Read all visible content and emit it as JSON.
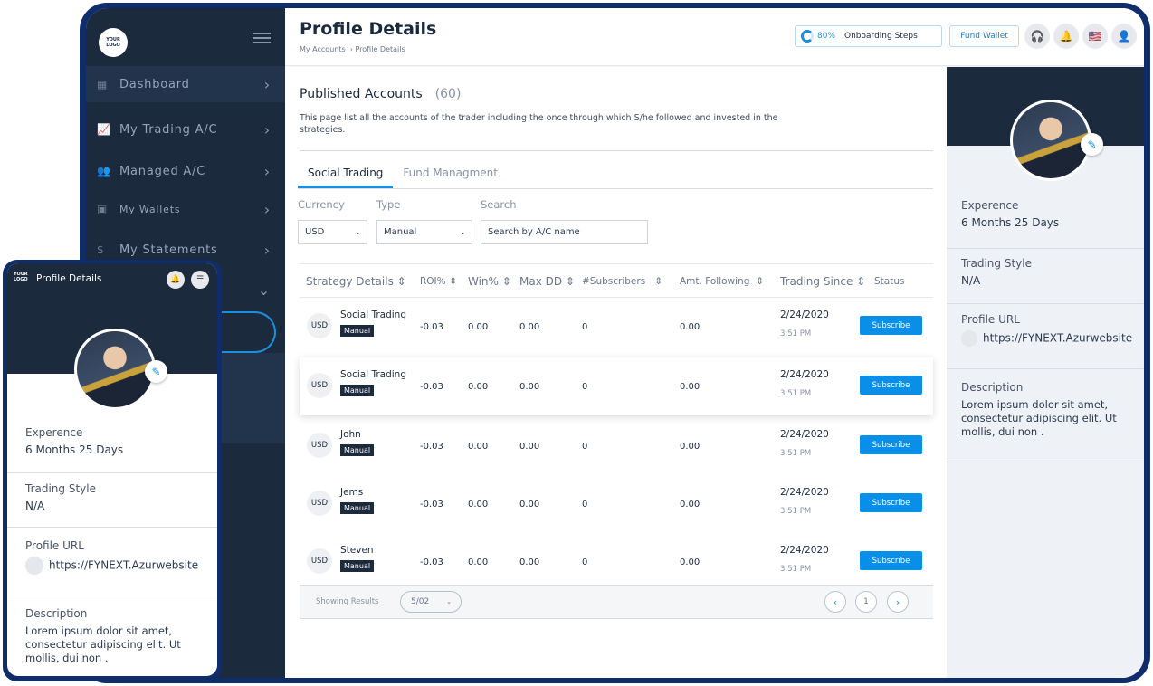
{
  "sidebar": {
    "logo": [
      "YOUR",
      "LOGO"
    ],
    "items": [
      {
        "label": "Dashboard",
        "icon": "dashboard-icon"
      },
      {
        "label": "My Trading A/C",
        "icon": "chart-icon"
      },
      {
        "label": "Managed A/C",
        "icon": "users-icon"
      },
      {
        "label": "My Wallets",
        "icon": "wallet-icon"
      },
      {
        "label": "My Statements",
        "icon": "statement-icon"
      }
    ]
  },
  "header": {
    "title": "Profile Details",
    "breadcrumb": [
      "My Accounts",
      "Profile Details"
    ],
    "onboarding_pct": "80%",
    "onboarding_label": "Onboarding Steps",
    "fund_wallet": "Fund Wallet"
  },
  "content": {
    "title": "Published Accounts",
    "count": "(60)",
    "description": "This page list all the accounts of the trader including the once through which S/he followed and invested in the strategies.",
    "tabs": [
      "Social Trading",
      "Fund Managment"
    ],
    "filters": {
      "currency_label": "Currency",
      "currency_value": "USD",
      "type_label": "Type",
      "type_value": "Manual",
      "search_label": "Search",
      "search_placeholder": "Search by A/C name"
    },
    "columns": [
      "Strategy Details",
      "ROI%",
      "Win%",
      "Max DD",
      "#Subscribers",
      "Amt. Following",
      "Trading Since",
      "Status"
    ],
    "rows": [
      {
        "currency": "USD",
        "name": "Social Trading",
        "type": "Manual",
        "roi": "-0.03",
        "win": "0.00",
        "maxdd": "0.00",
        "subs": "0",
        "amt": "0.00",
        "date": "2/24/2020",
        "time": "3:51 PM",
        "action": "Subscribe"
      },
      {
        "currency": "USD",
        "name": "Social Trading",
        "type": "Manual",
        "roi": "-0.03",
        "win": "0.00",
        "maxdd": "0.00",
        "subs": "0",
        "amt": "0.00",
        "date": "2/24/2020",
        "time": "3:51 PM",
        "action": "Subscribe"
      },
      {
        "currency": "USD",
        "name": "John",
        "type": "Manual",
        "roi": "-0.03",
        "win": "0.00",
        "maxdd": "0.00",
        "subs": "0",
        "amt": "0.00",
        "date": "2/24/2020",
        "time": "3:51 PM",
        "action": "Subscribe"
      },
      {
        "currency": "USD",
        "name": "Jems",
        "type": "Manual",
        "roi": "-0.03",
        "win": "0.00",
        "maxdd": "0.00",
        "subs": "0",
        "amt": "0.00",
        "date": "2/24/2020",
        "time": "3:51 PM",
        "action": "Subscribe"
      },
      {
        "currency": "USD",
        "name": "Steven",
        "type": "Manual",
        "roi": "-0.03",
        "win": "0.00",
        "maxdd": "0.00",
        "subs": "0",
        "amt": "0.00",
        "date": "2/24/2020",
        "time": "3:51 PM",
        "action": "Subscribe"
      }
    ],
    "footer": {
      "showing": "Showing Results",
      "per_page": "5/02",
      "page": "1"
    }
  },
  "profile": {
    "experience_label": "Experence",
    "experience_value": "6 Months 25 Days",
    "style_label": "Trading Style",
    "style_value": "N/A",
    "url_label": "Profile URL",
    "url_value": "https://FYNEXT.Azurwebsite",
    "desc_label": "Description",
    "desc_value": "Lorem ipsum dolor sit amet, consectetur adipiscing elit. Ut mollis, dui non ."
  },
  "mobile": {
    "title": "Profile Details",
    "logo": [
      "YOUR",
      "LOGO"
    ]
  }
}
